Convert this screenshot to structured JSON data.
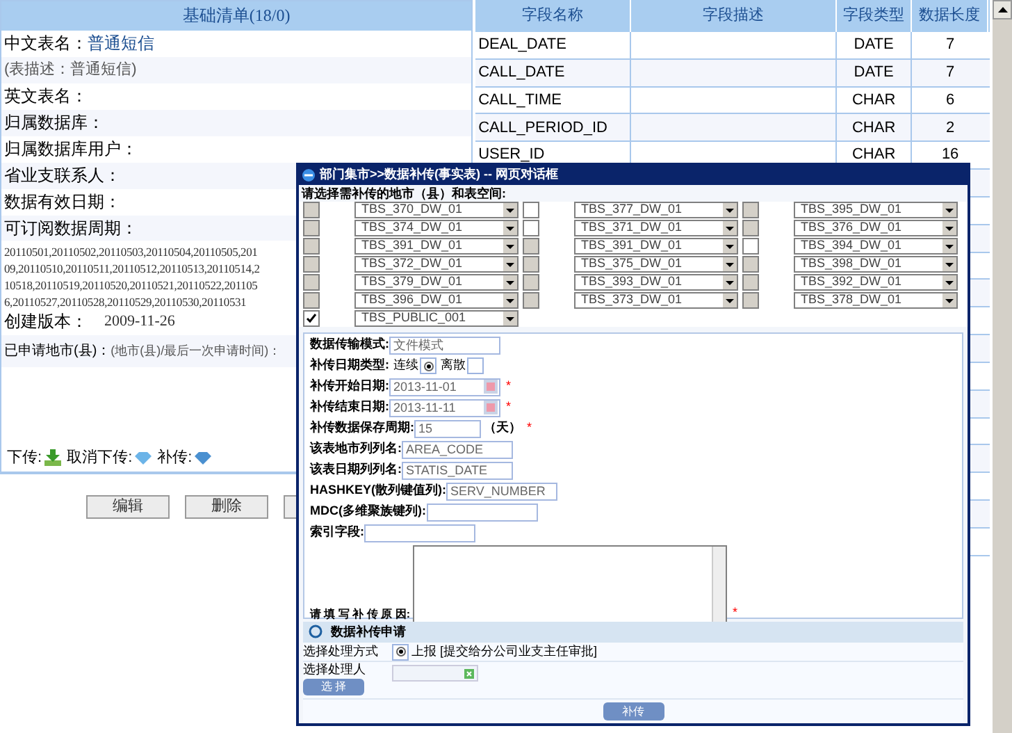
{
  "left_panel": {
    "title": "基础清单(18/0)",
    "chinese_name": {
      "label": "中文表名：",
      "value": "普通短信"
    },
    "description": "(表描述：普通短信)",
    "labels": [
      "英文表名：",
      "归属数据库：",
      "归属数据库用户：",
      "省业支联系人：",
      "数据有效日期：",
      "可订阅数据周期："
    ],
    "period_lines": [
      "20110501,20110502,20110503,20110504,20110505,201",
      "09,20110510,20110511,20110512,20110513,20110514,2",
      "10518,20110519,20110520,20110521,20110522,201105",
      "6,20110527,20110528,20110529,20110530,20110531"
    ],
    "version": {
      "label": "创建版本：",
      "value": "2009-11-26"
    },
    "applied": {
      "label": "已申请地市(县)：",
      "value": "(地市(县)/最后一次申请时间)："
    },
    "legend": [
      {
        "kind": "download",
        "label": "下传:"
      },
      {
        "kind": "cancel",
        "label": "取消下传:"
      },
      {
        "kind": "resend",
        "label": "补传:"
      }
    ],
    "buttons": [
      "编辑",
      "删除"
    ]
  },
  "table": {
    "columns": [
      "字段名称",
      "字段描述",
      "字段类型",
      "数据长度"
    ],
    "rows": [
      {
        "name": "DEAL_DATE",
        "type": "DATE",
        "length": "7"
      },
      {
        "name": "CALL_DATE",
        "type": "DATE",
        "length": "7"
      },
      {
        "name": "CALL_TIME",
        "type": "CHAR",
        "length": "6"
      },
      {
        "name": "CALL_PERIOD_ID",
        "type": "CHAR",
        "length": "2"
      },
      {
        "name": "USER_ID",
        "type": "CHAR",
        "length": "16"
      }
    ]
  },
  "dialog": {
    "title": "部门集市>>数据补传(事实表) -- 网页对话框",
    "prompt": "请选择需补传的地市（县）和表空间:",
    "tablespaces": [
      [
        {
          "value": "TBS_370_DW_01",
          "checked": false,
          "disabled": true
        },
        {
          "value": "TBS_377_DW_01",
          "checked": false,
          "disabled": false
        },
        {
          "value": "TBS_395_DW_01",
          "checked": false,
          "disabled": true
        }
      ],
      [
        {
          "value": "TBS_374_DW_01",
          "checked": false,
          "disabled": true
        },
        {
          "value": "TBS_371_DW_01",
          "checked": false,
          "disabled": false
        },
        {
          "value": "TBS_376_DW_01",
          "checked": false,
          "disabled": true
        }
      ],
      [
        {
          "value": "TBS_391_DW_01",
          "checked": false,
          "disabled": true
        },
        {
          "value": "TBS_391_DW_01",
          "checked": false,
          "disabled": true
        },
        {
          "value": "TBS_394_DW_01",
          "checked": false,
          "disabled": false
        }
      ],
      [
        {
          "value": "TBS_372_DW_01",
          "checked": false,
          "disabled": true
        },
        {
          "value": "TBS_375_DW_01",
          "checked": false,
          "disabled": true
        },
        {
          "value": "TBS_398_DW_01",
          "checked": false,
          "disabled": true
        }
      ],
      [
        {
          "value": "TBS_379_DW_01",
          "checked": false,
          "disabled": true
        },
        {
          "value": "TBS_393_DW_01",
          "checked": false,
          "disabled": true
        },
        {
          "value": "TBS_392_DW_01",
          "checked": false,
          "disabled": true
        }
      ],
      [
        {
          "value": "TBS_396_DW_01",
          "checked": false,
          "disabled": true
        },
        {
          "value": "TBS_373_DW_01",
          "checked": false,
          "disabled": true
        },
        {
          "value": "TBS_378_DW_01",
          "checked": false,
          "disabled": true
        }
      ],
      [
        {
          "value": "TBS_PUBLIC_001",
          "checked": true,
          "disabled": false
        }
      ]
    ],
    "transfer_mode": {
      "label": "数据传输模式:",
      "value": "文件模式"
    },
    "date_type": {
      "label": "补传日期类型:",
      "options": [
        {
          "label": "连续",
          "selected": true
        },
        {
          "label": "离散",
          "selected": false
        }
      ]
    },
    "dates": [
      {
        "label": "补传开始日期:",
        "value": "2013-11-01",
        "required": true
      },
      {
        "label": "补传结束日期:",
        "value": "2013-11-11",
        "required": true
      }
    ],
    "retention": {
      "label": "补传数据保存周期:",
      "value": "15",
      "unit": "（天）",
      "required": true
    },
    "text_fields": [
      {
        "label": "该表地市列列名:",
        "value": "AREA_CODE"
      },
      {
        "label": "该表日期列列名:",
        "value": "STATIS_DATE"
      },
      {
        "label": "HASHKEY(散列键值列):",
        "value": "SERV_NUMBER"
      },
      {
        "label": "MDC(多维聚族键列):"
      },
      {
        "label": "索引字段:"
      }
    ],
    "reason": {
      "label": "请 填 写 补 传 原 因:",
      "required": true
    },
    "required_mark": "*",
    "application": {
      "title": "数据补传申请",
      "method_label": "选择处理方式",
      "method_option": {
        "label": "上报 [提交给分公司业支主任审批]",
        "selected": true
      },
      "handler_label": "选择处理人",
      "select_button": "选 择",
      "submit": "补传"
    }
  }
}
